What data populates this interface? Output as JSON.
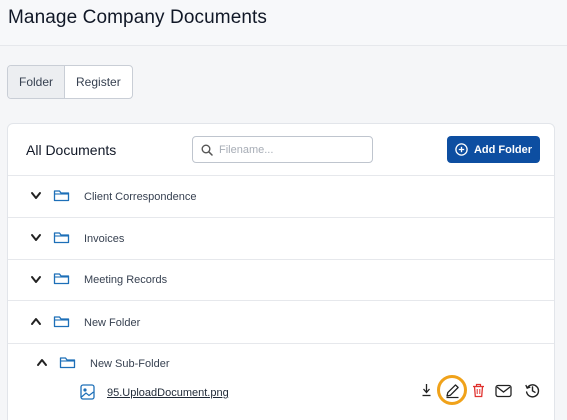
{
  "header": {
    "title": "Manage Company Documents"
  },
  "view_toggle": {
    "options": [
      {
        "label": "Folder",
        "active": true
      },
      {
        "label": "Register",
        "active": false
      }
    ]
  },
  "documents": {
    "title": "All Documents",
    "search_placeholder": "Filename...",
    "add_folder_label": "Add Folder",
    "folders": [
      {
        "label": "Client Correspondence",
        "expanded": false
      },
      {
        "label": "Invoices",
        "expanded": false
      },
      {
        "label": "Meeting Records",
        "expanded": false
      },
      {
        "label": "New Folder",
        "expanded": true
      }
    ],
    "subfolder": {
      "label": "New Sub-Folder",
      "expanded": true
    },
    "file": {
      "name": "95.UploadDocument.png"
    }
  },
  "colors": {
    "primary": "#0d4ea1",
    "folder_icon": "#1d6fb8",
    "delete_icon": "#e0322f",
    "highlight": "#f0a21a"
  },
  "icons": {
    "search": "search-icon",
    "add": "plus-circle-icon",
    "download": "download-icon",
    "edit": "pencil-icon",
    "delete": "trash-icon",
    "email": "envelope-icon",
    "history": "history-icon"
  }
}
